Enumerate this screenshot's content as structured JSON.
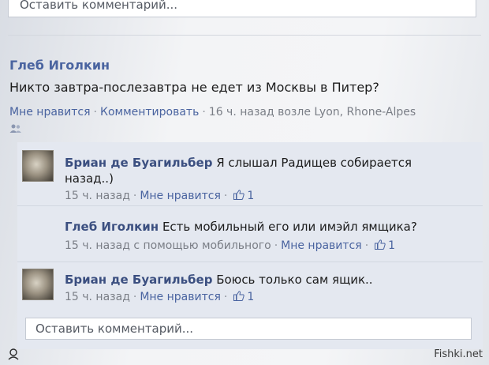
{
  "top_comment_box": {
    "placeholder": "Оставить комментарий..."
  },
  "post": {
    "author": "Глеб Иголкин",
    "text": "Никто завтра-послезавтра не едет из Москвы в Питер?",
    "meta": {
      "like": "Мне нравится",
      "comment": "Комментировать",
      "time": "16 ч. назад возле Lyon, Rhone-Alpes"
    }
  },
  "comments": [
    {
      "author": "Бриан де Буагильбер",
      "text": "Я слышал Радищев собирается",
      "text2": "назад..)",
      "time": "15 ч. назад",
      "like": "Мне нравится",
      "likes": "1",
      "has_avatar": true
    },
    {
      "author": "Глеб Иголкин",
      "text": "Есть мобильный его или имэйл ямщика?",
      "time": "15 ч. назад с помощью мобильного",
      "like": "Мне нравится",
      "likes": "1",
      "has_avatar": false
    },
    {
      "author": "Бриан де Буагильбер",
      "text": "Боюсь только сам ящик..",
      "time": "15 ч. назад",
      "like": "Мне нравится",
      "likes": "1",
      "has_avatar": true
    }
  ],
  "reply_box": {
    "placeholder": "Оставить комментарий..."
  },
  "separator": "·",
  "watermark": "Fishki.net"
}
